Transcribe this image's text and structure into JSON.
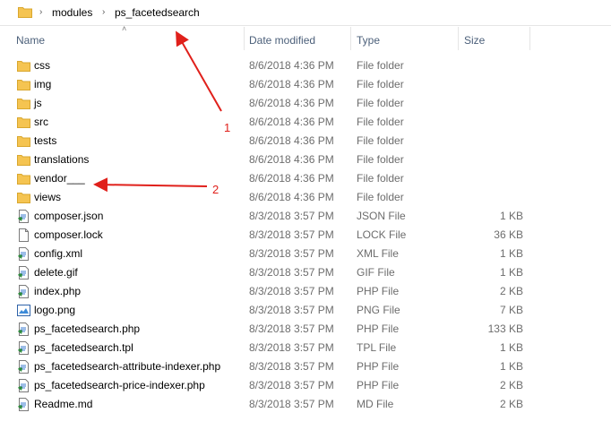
{
  "address_bar": {
    "crumbs": [
      "modules",
      "ps_facetedsearch"
    ]
  },
  "columns": {
    "name": "Name",
    "date": "Date modified",
    "type": "Type",
    "size": "Size"
  },
  "files": [
    {
      "name": "css",
      "date": "8/6/2018 4:36 PM",
      "type": "File folder",
      "size": "",
      "icon": "folder-icon"
    },
    {
      "name": "img",
      "date": "8/6/2018 4:36 PM",
      "type": "File folder",
      "size": "",
      "icon": "folder-icon"
    },
    {
      "name": "js",
      "date": "8/6/2018 4:36 PM",
      "type": "File folder",
      "size": "",
      "icon": "folder-icon"
    },
    {
      "name": "src",
      "date": "8/6/2018 4:36 PM",
      "type": "File folder",
      "size": "",
      "icon": "folder-icon"
    },
    {
      "name": "tests",
      "date": "8/6/2018 4:36 PM",
      "type": "File folder",
      "size": "",
      "icon": "folder-icon"
    },
    {
      "name": "translations",
      "date": "8/6/2018 4:36 PM",
      "type": "File folder",
      "size": "",
      "icon": "folder-icon"
    },
    {
      "name": "vendor___",
      "date": "8/6/2018 4:36 PM",
      "type": "File folder",
      "size": "",
      "icon": "folder-icon"
    },
    {
      "name": "views",
      "date": "8/6/2018 4:36 PM",
      "type": "File folder",
      "size": "",
      "icon": "folder-icon"
    },
    {
      "name": "composer.json",
      "date": "8/3/2018 3:57 PM",
      "type": "JSON File",
      "size": "1 KB",
      "icon": "script-file-icon"
    },
    {
      "name": "composer.lock",
      "date": "8/3/2018 3:57 PM",
      "type": "LOCK File",
      "size": "36 KB",
      "icon": "blank-file-icon"
    },
    {
      "name": "config.xml",
      "date": "8/3/2018 3:57 PM",
      "type": "XML File",
      "size": "1 KB",
      "icon": "script-file-icon"
    },
    {
      "name": "delete.gif",
      "date": "8/3/2018 3:57 PM",
      "type": "GIF File",
      "size": "1 KB",
      "icon": "script-file-icon"
    },
    {
      "name": "index.php",
      "date": "8/3/2018 3:57 PM",
      "type": "PHP File",
      "size": "2 KB",
      "icon": "script-file-icon"
    },
    {
      "name": "logo.png",
      "date": "8/3/2018 3:57 PM",
      "type": "PNG File",
      "size": "7 KB",
      "icon": "image-file-icon"
    },
    {
      "name": "ps_facetedsearch.php",
      "date": "8/3/2018 3:57 PM",
      "type": "PHP File",
      "size": "133 KB",
      "icon": "script-file-icon"
    },
    {
      "name": "ps_facetedsearch.tpl",
      "date": "8/3/2018 3:57 PM",
      "type": "TPL File",
      "size": "1 KB",
      "icon": "script-file-icon"
    },
    {
      "name": "ps_facetedsearch-attribute-indexer.php",
      "date": "8/3/2018 3:57 PM",
      "type": "PHP File",
      "size": "1 KB",
      "icon": "script-file-icon"
    },
    {
      "name": "ps_facetedsearch-price-indexer.php",
      "date": "8/3/2018 3:57 PM",
      "type": "PHP File",
      "size": "2 KB",
      "icon": "script-file-icon"
    },
    {
      "name": "Readme.md",
      "date": "8/3/2018 3:57 PM",
      "type": "MD File",
      "size": "2 KB",
      "icon": "script-file-icon"
    }
  ],
  "annotations": {
    "one": "1",
    "two": "2"
  },
  "colors": {
    "folder": "#f5c451",
    "annotation": "#e0201b",
    "header_text": "#4c607a"
  }
}
